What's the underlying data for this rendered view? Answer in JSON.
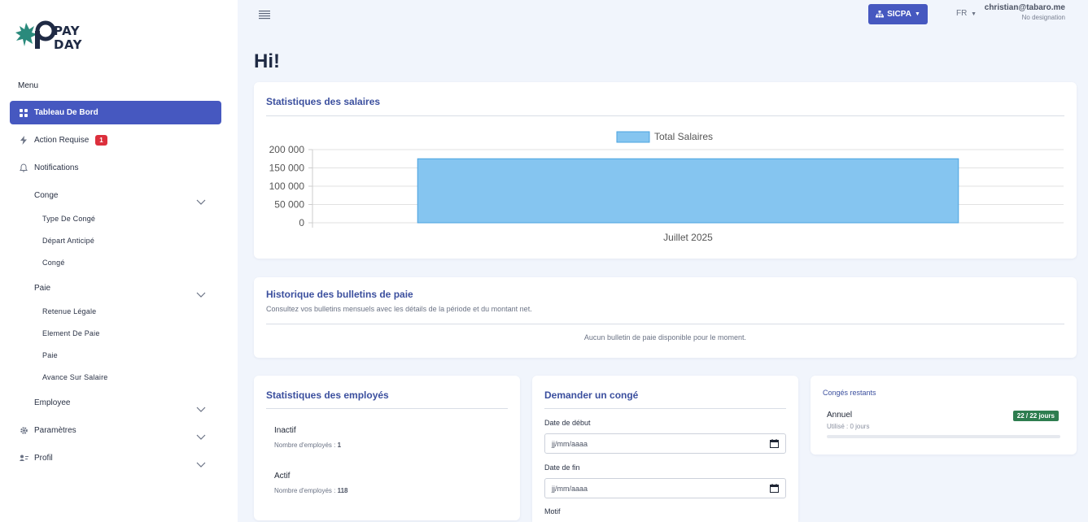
{
  "brand": {
    "line1": "PAY",
    "line2": "DAY",
    "primary_color": "#4658c0"
  },
  "sidebar": {
    "menu_heading": "Menu",
    "dashboard": {
      "label": "Tableau De Bord",
      "icon": "grid-icon"
    },
    "action_required": {
      "label": "Action Requise",
      "badge": "1",
      "icon": "bolt-icon"
    },
    "notifications": {
      "label": "Notifications",
      "icon": "bell-icon"
    },
    "conge": {
      "label": "Conge",
      "items": [
        "Type De Congé",
        "Départ Anticipé",
        "Congé"
      ]
    },
    "paie": {
      "label": "Paie",
      "items": [
        "Retenue Légale",
        "Element De Paie",
        "Paie",
        "Avance Sur Salaire"
      ]
    },
    "employee": {
      "label": "Employee"
    },
    "parametres": {
      "label": "Paramètres",
      "icon": "gear-icon"
    },
    "profil": {
      "label": "Profil",
      "icon": "user-card-icon"
    }
  },
  "topbar": {
    "org_label": "SICPA",
    "language": "FR",
    "user_email": "christian@tabaro.me",
    "user_designation": "No designation"
  },
  "greeting": "Hi!",
  "salary_stats": {
    "title": "Statistiques des salaires"
  },
  "chart_data": {
    "type": "bar",
    "categories": [
      "Juillet 2025"
    ],
    "series": [
      {
        "name": "Total Salaires",
        "values": [
          175000
        ]
      }
    ],
    "ylim": [
      0,
      200000
    ],
    "yticks": [
      "200 000",
      "150 000",
      "100 000",
      "50 000",
      "0"
    ],
    "legend": "top",
    "bar_color": "#85c5f0",
    "bar_border": "#4aa3e0"
  },
  "payslip_history": {
    "title": "Historique des bulletins de paie",
    "subtitle": "Consultez vos bulletins mensuels avec les détails de la période et du montant net.",
    "empty": "Aucun bulletin de paie disponible pour le moment."
  },
  "employee_stats": {
    "title": "Statistiques des employés",
    "count_label": "Nombre d'employés :",
    "rows": [
      {
        "status": "Inactif",
        "count": "1"
      },
      {
        "status": "Actif",
        "count": "118"
      }
    ]
  },
  "leave_request": {
    "title": "Demander un congé",
    "start_label": "Date de début",
    "start_placeholder": "jj/mm/aaaa",
    "end_label": "Date de fin",
    "end_placeholder": "jj/mm/aaaa",
    "reason_label": "Motif"
  },
  "remaining_leave": {
    "title": "Congés restants",
    "type": "Annuel",
    "used": "Utilisé : 0 jours",
    "badge": "22 / 22 jours",
    "used_fraction": 0
  }
}
